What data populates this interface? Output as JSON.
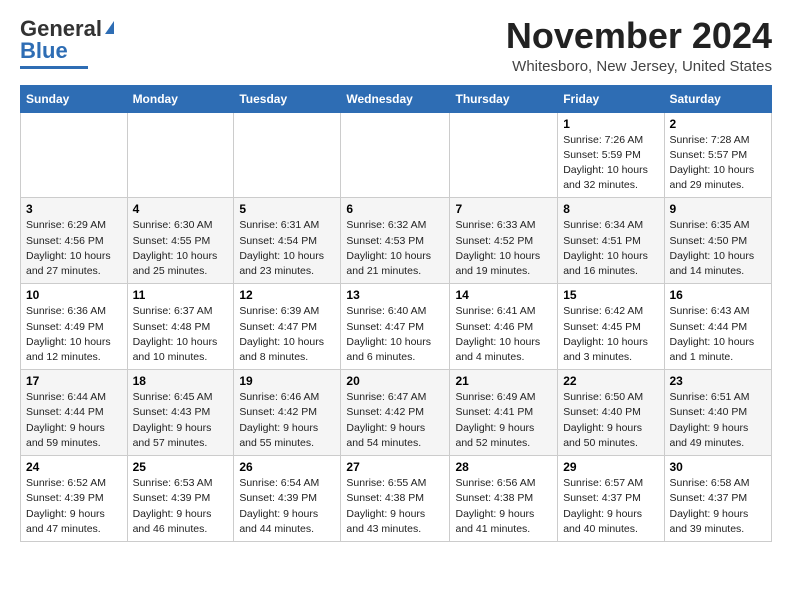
{
  "logo": {
    "line1": "General",
    "line2": "Blue"
  },
  "header": {
    "month_title": "November 2024",
    "location": "Whitesboro, New Jersey, United States"
  },
  "weekdays": [
    "Sunday",
    "Monday",
    "Tuesday",
    "Wednesday",
    "Thursday",
    "Friday",
    "Saturday"
  ],
  "weeks": [
    [
      {
        "day": "",
        "info": ""
      },
      {
        "day": "",
        "info": ""
      },
      {
        "day": "",
        "info": ""
      },
      {
        "day": "",
        "info": ""
      },
      {
        "day": "",
        "info": ""
      },
      {
        "day": "1",
        "info": "Sunrise: 7:26 AM\nSunset: 5:59 PM\nDaylight: 10 hours\nand 32 minutes."
      },
      {
        "day": "2",
        "info": "Sunrise: 7:28 AM\nSunset: 5:57 PM\nDaylight: 10 hours\nand 29 minutes."
      }
    ],
    [
      {
        "day": "3",
        "info": "Sunrise: 6:29 AM\nSunset: 4:56 PM\nDaylight: 10 hours\nand 27 minutes."
      },
      {
        "day": "4",
        "info": "Sunrise: 6:30 AM\nSunset: 4:55 PM\nDaylight: 10 hours\nand 25 minutes."
      },
      {
        "day": "5",
        "info": "Sunrise: 6:31 AM\nSunset: 4:54 PM\nDaylight: 10 hours\nand 23 minutes."
      },
      {
        "day": "6",
        "info": "Sunrise: 6:32 AM\nSunset: 4:53 PM\nDaylight: 10 hours\nand 21 minutes."
      },
      {
        "day": "7",
        "info": "Sunrise: 6:33 AM\nSunset: 4:52 PM\nDaylight: 10 hours\nand 19 minutes."
      },
      {
        "day": "8",
        "info": "Sunrise: 6:34 AM\nSunset: 4:51 PM\nDaylight: 10 hours\nand 16 minutes."
      },
      {
        "day": "9",
        "info": "Sunrise: 6:35 AM\nSunset: 4:50 PM\nDaylight: 10 hours\nand 14 minutes."
      }
    ],
    [
      {
        "day": "10",
        "info": "Sunrise: 6:36 AM\nSunset: 4:49 PM\nDaylight: 10 hours\nand 12 minutes."
      },
      {
        "day": "11",
        "info": "Sunrise: 6:37 AM\nSunset: 4:48 PM\nDaylight: 10 hours\nand 10 minutes."
      },
      {
        "day": "12",
        "info": "Sunrise: 6:39 AM\nSunset: 4:47 PM\nDaylight: 10 hours\nand 8 minutes."
      },
      {
        "day": "13",
        "info": "Sunrise: 6:40 AM\nSunset: 4:47 PM\nDaylight: 10 hours\nand 6 minutes."
      },
      {
        "day": "14",
        "info": "Sunrise: 6:41 AM\nSunset: 4:46 PM\nDaylight: 10 hours\nand 4 minutes."
      },
      {
        "day": "15",
        "info": "Sunrise: 6:42 AM\nSunset: 4:45 PM\nDaylight: 10 hours\nand 3 minutes."
      },
      {
        "day": "16",
        "info": "Sunrise: 6:43 AM\nSunset: 4:44 PM\nDaylight: 10 hours\nand 1 minute."
      }
    ],
    [
      {
        "day": "17",
        "info": "Sunrise: 6:44 AM\nSunset: 4:44 PM\nDaylight: 9 hours\nand 59 minutes."
      },
      {
        "day": "18",
        "info": "Sunrise: 6:45 AM\nSunset: 4:43 PM\nDaylight: 9 hours\nand 57 minutes."
      },
      {
        "day": "19",
        "info": "Sunrise: 6:46 AM\nSunset: 4:42 PM\nDaylight: 9 hours\nand 55 minutes."
      },
      {
        "day": "20",
        "info": "Sunrise: 6:47 AM\nSunset: 4:42 PM\nDaylight: 9 hours\nand 54 minutes."
      },
      {
        "day": "21",
        "info": "Sunrise: 6:49 AM\nSunset: 4:41 PM\nDaylight: 9 hours\nand 52 minutes."
      },
      {
        "day": "22",
        "info": "Sunrise: 6:50 AM\nSunset: 4:40 PM\nDaylight: 9 hours\nand 50 minutes."
      },
      {
        "day": "23",
        "info": "Sunrise: 6:51 AM\nSunset: 4:40 PM\nDaylight: 9 hours\nand 49 minutes."
      }
    ],
    [
      {
        "day": "24",
        "info": "Sunrise: 6:52 AM\nSunset: 4:39 PM\nDaylight: 9 hours\nand 47 minutes."
      },
      {
        "day": "25",
        "info": "Sunrise: 6:53 AM\nSunset: 4:39 PM\nDaylight: 9 hours\nand 46 minutes."
      },
      {
        "day": "26",
        "info": "Sunrise: 6:54 AM\nSunset: 4:39 PM\nDaylight: 9 hours\nand 44 minutes."
      },
      {
        "day": "27",
        "info": "Sunrise: 6:55 AM\nSunset: 4:38 PM\nDaylight: 9 hours\nand 43 minutes."
      },
      {
        "day": "28",
        "info": "Sunrise: 6:56 AM\nSunset: 4:38 PM\nDaylight: 9 hours\nand 41 minutes."
      },
      {
        "day": "29",
        "info": "Sunrise: 6:57 AM\nSunset: 4:37 PM\nDaylight: 9 hours\nand 40 minutes."
      },
      {
        "day": "30",
        "info": "Sunrise: 6:58 AM\nSunset: 4:37 PM\nDaylight: 9 hours\nand 39 minutes."
      }
    ]
  ]
}
